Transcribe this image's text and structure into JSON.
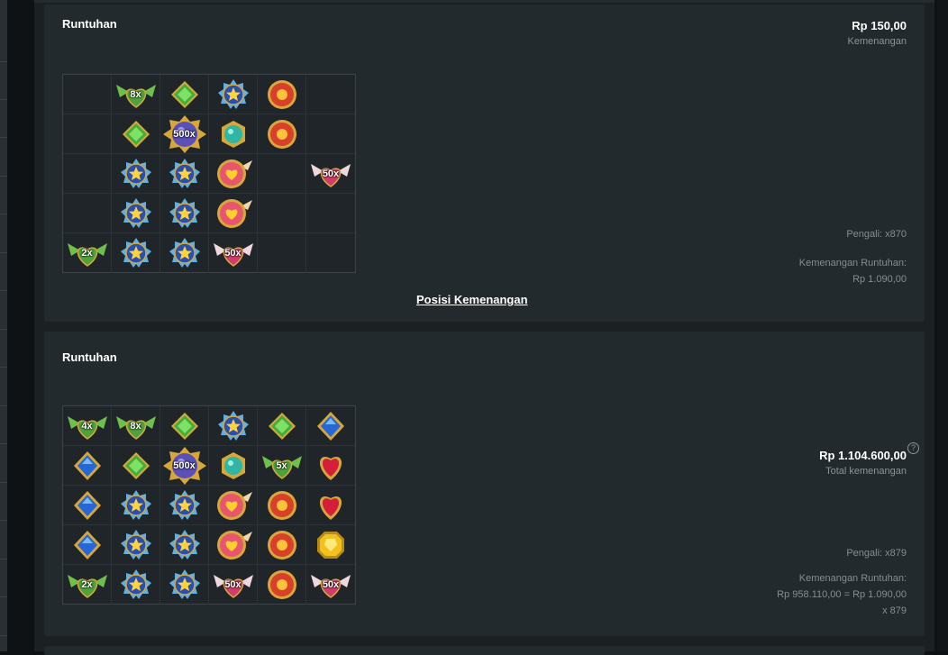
{
  "panels": [
    {
      "title": "Runtuhan",
      "amount": "Rp 150,00",
      "amount_label": "Kemenangan",
      "pengali": "Pengali: x870",
      "cascade_label": "Kemenangan Runtuhan:",
      "cascade_value": "Rp 1.090,00",
      "link": "Posisi Kemenangan",
      "grid": [
        [
          "",
          "green-heart-wings",
          "green-gem",
          "blue-star",
          "red-sun",
          ""
        ],
        [
          "",
          "green-gem",
          "purple-orb",
          "teal-gem",
          "red-sun",
          ""
        ],
        [
          "",
          "blue-star",
          "blue-star",
          "pink-heart",
          "",
          "pink-heart-wings"
        ],
        [
          "",
          "blue-star",
          "blue-star",
          "pink-heart",
          "",
          ""
        ],
        [
          "green-heart-wings",
          "blue-star",
          "blue-star",
          "pink-heart-wings",
          "",
          ""
        ]
      ],
      "multipliers": [
        [
          "",
          "8x",
          "",
          "",
          "",
          ""
        ],
        [
          "",
          "",
          "500x",
          "",
          "",
          ""
        ],
        [
          "",
          "",
          "",
          "",
          "",
          "50x"
        ],
        [
          "",
          "",
          "",
          "",
          "",
          ""
        ],
        [
          "2x",
          "",
          "",
          "50x",
          "",
          ""
        ]
      ]
    },
    {
      "title": "Runtuhan",
      "total_amount": "Rp 1.104.600,00",
      "total_label": "Total kemenangan",
      "pengali": "Pengali: x879",
      "cascade_label": "Kemenangan Runtuhan:",
      "cascade_formula": "Rp 958.110,00 = Rp 1.090,00",
      "cascade_mult": "x 879",
      "grid": [
        [
          "green-heart-wings",
          "green-heart-wings",
          "green-gem",
          "blue-star",
          "green-gem",
          "blue-gem"
        ],
        [
          "blue-gem",
          "green-gem",
          "purple-orb",
          "teal-gem",
          "green-heart-wings",
          "red-heart"
        ],
        [
          "blue-gem",
          "blue-star",
          "blue-star",
          "pink-heart",
          "red-sun",
          "red-heart"
        ],
        [
          "blue-gem",
          "blue-star",
          "blue-star",
          "pink-heart",
          "red-sun",
          "yellow-gem"
        ],
        [
          "green-heart-wings",
          "blue-star",
          "blue-star",
          "pink-heart-wings",
          "red-sun",
          "pink-heart-wings"
        ]
      ],
      "multipliers": [
        [
          "4x",
          "8x",
          "",
          "",
          "",
          ""
        ],
        [
          "",
          "",
          "500x",
          "",
          "5x",
          ""
        ],
        [
          "",
          "",
          "",
          "",
          "",
          ""
        ],
        [
          "",
          "",
          "",
          "",
          "",
          ""
        ],
        [
          "2x",
          "",
          "",
          "50x",
          "",
          "50x"
        ]
      ]
    }
  ],
  "symbol_colors": {
    "blue-star": "#2b4fb0",
    "green-gem": "#3fae3a",
    "red-sun": "#d8402a",
    "teal-gem": "#2fb6a4",
    "purple-orb": "#5b4fb8",
    "pink-heart": "#e8566e",
    "red-heart": "#d41f3a",
    "blue-gem": "#2566d8",
    "yellow-gem": "#f1c21d",
    "green-heart-wings": "#4fa23a",
    "pink-heart-wings": "#cf3d6a",
    "gold-frame": "#d7a739"
  }
}
